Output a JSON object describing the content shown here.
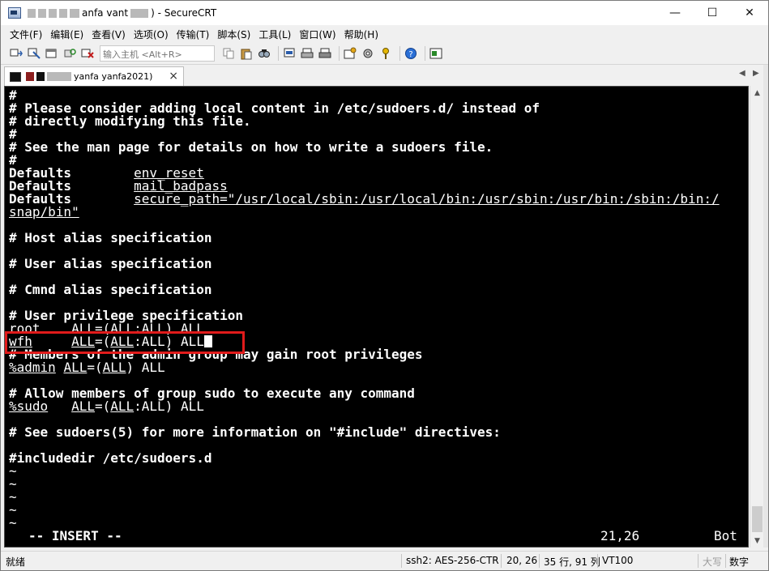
{
  "window": {
    "title_visible": "anfa vant",
    "title_suffix": ") - SecureCRT",
    "controls": {
      "minimize": "—",
      "maximize": "☐",
      "close": "✕"
    }
  },
  "menu": {
    "items": [
      "文件(F)",
      "编辑(E)",
      "查看(V)",
      "选项(O)",
      "传输(T)",
      "脚本(S)",
      "工具(L)",
      "窗口(W)",
      "帮助(H)"
    ]
  },
  "toolbar": {
    "host_placeholder": "输入主机 <Alt+R>"
  },
  "tab": {
    "label_visible": "yanfa yanfa2021)",
    "close": "×",
    "nav_left": "◀",
    "nav_right": "▶"
  },
  "terminal": {
    "l1": "#",
    "l2": "# Please consider adding local content in /etc/sudoers.d/ instead of",
    "l3": "# directly modifying this file.",
    "l4": "#",
    "l5": "# See the man page for details on how to write a sudoers file.",
    "l6": "#",
    "defaults_kw": "Defaults",
    "d1_val": "env_reset",
    "d2_val": "mail_badpass",
    "d3_val": "secure_path=\"/usr/local/sbin:/usr/local/bin:/usr/sbin:/usr/bin:/sbin:/bin:/",
    "d3_cont": "snap/bin\"",
    "host_alias": "# Host alias specification",
    "user_alias": "# User alias specification",
    "cmnd_alias": "# Cmnd alias specification",
    "user_priv": "# User privilege specification",
    "root_user": "root",
    "root_rule": "ALL=(ALL:ALL) ALL",
    "wfh_user": "wfh",
    "wfh_all1": "ALL",
    "wfh_eq": "=(",
    "wfh_all2": "ALL",
    "wfh_rest": ":ALL) ALL",
    "admin_comment": "# Members of the admin group may gain root privileges",
    "admin_grp": "%admin",
    "admin_all1": "ALL",
    "admin_mid": "=(",
    "admin_all2": "ALL",
    "admin_end": ") ALL",
    "sudo_comment": "# Allow members of group sudo to execute any command",
    "sudo_grp": "%sudo",
    "sudo_all1": "ALL",
    "sudo_mid": "=(",
    "sudo_all2": "ALL",
    "sudo_end": ":ALL) ALL",
    "include_comment": "# See sudoers(5) for more information on \"#include\" directives:",
    "includedir": "#includedir /etc/sudoers.d",
    "tilde": "~",
    "mode": "-- INSERT --",
    "position": "21,26",
    "scroll_pos": "Bot"
  },
  "statusbar": {
    "ready": "就绪",
    "protocol": "ssh2: AES-256-CTR",
    "cursor_pos": "20, 26",
    "size": "35 行, 91 列",
    "emulation": "VT100",
    "caps": "大写",
    "num": "数字"
  }
}
